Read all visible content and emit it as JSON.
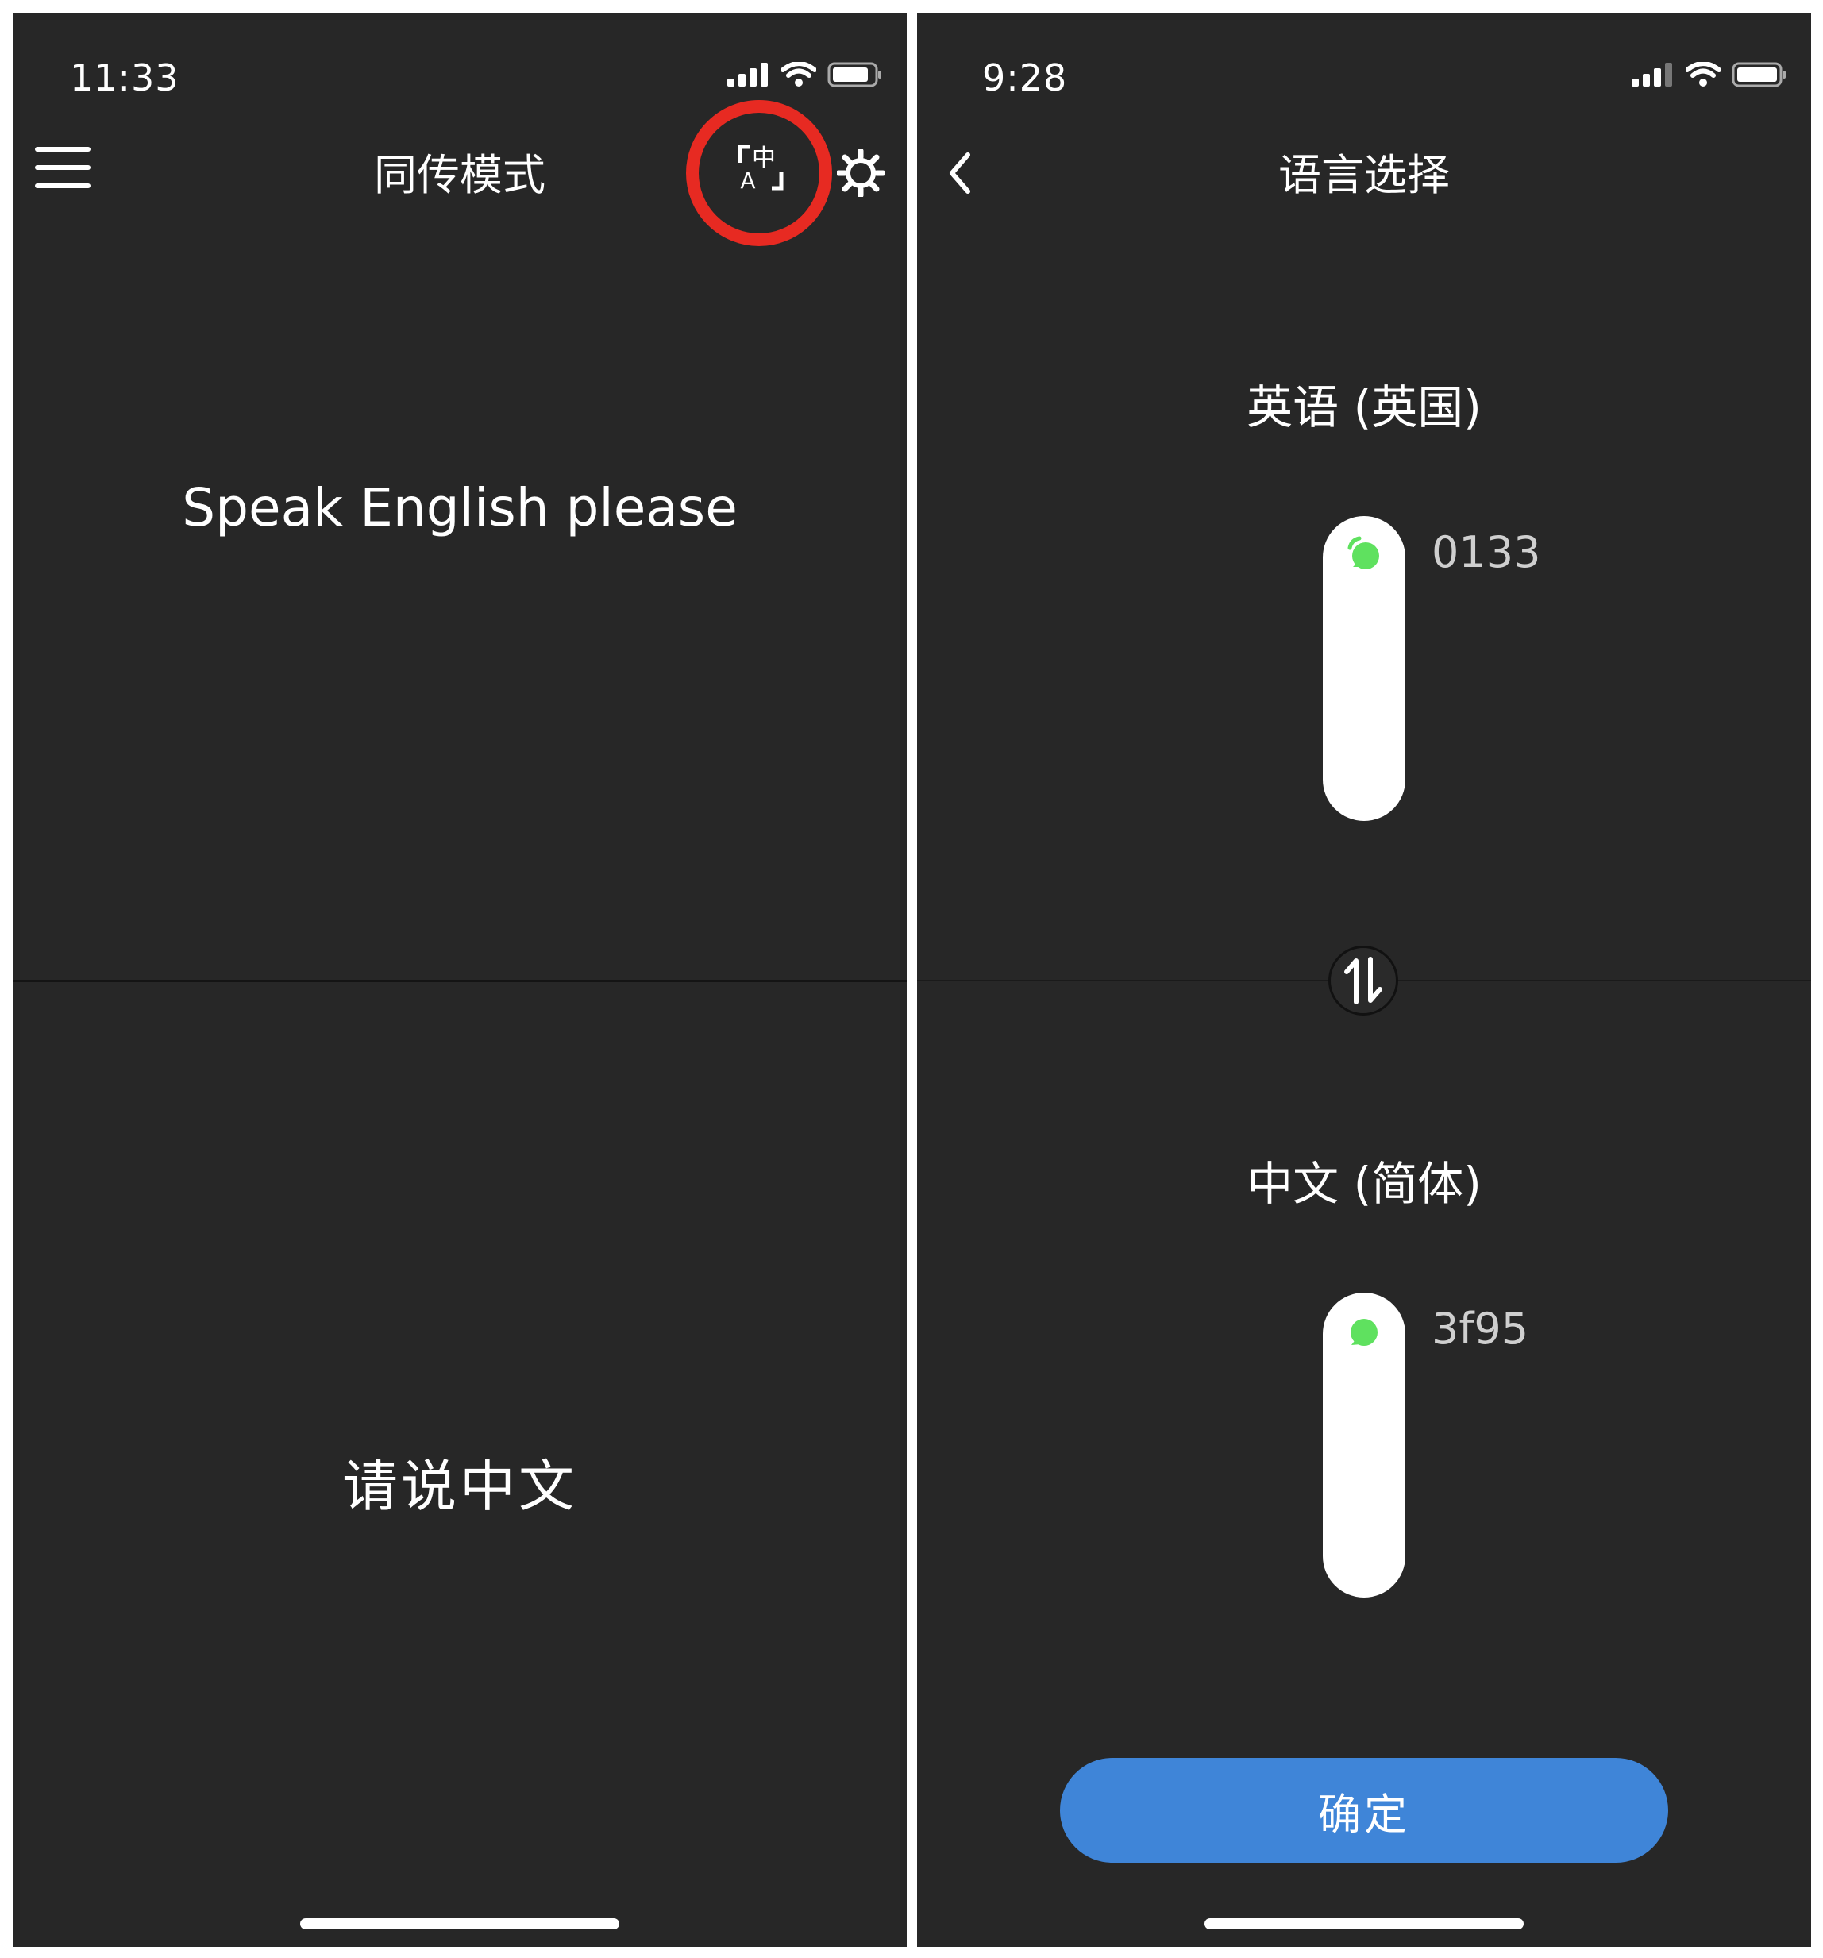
{
  "colors": {
    "screen_background": "#272727",
    "highlight_circle": "#e72a22",
    "confirm_button": "#3f85d8",
    "device_connected_dot": "#5fe15f"
  },
  "left_screen": {
    "status_time": "11:33",
    "title": "同传模式",
    "icons": [
      "menu-icon",
      "translate-language-icon",
      "gear-icon"
    ],
    "prompt_top": "Speak English please",
    "prompt_bottom": "请说中文"
  },
  "right_screen": {
    "status_time": "9:28",
    "title": "语言选择",
    "icons": [
      "back-icon",
      "swap-icon"
    ],
    "source_language": "英语 (英国)",
    "source_device_code": "0133",
    "target_language": "中文 (简体)",
    "target_device_code": "3f95",
    "confirm_label": "确定"
  }
}
